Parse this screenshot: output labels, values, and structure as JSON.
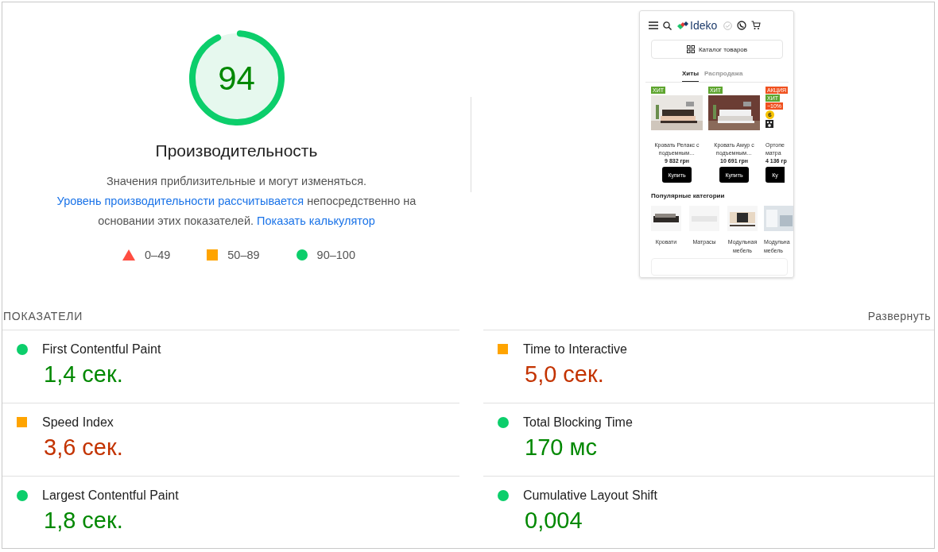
{
  "gauge": {
    "score": "94",
    "level": 0.94,
    "title": "Производительность"
  },
  "description": [
    {
      "kind": "text",
      "text": "Значения приблизительные и могут изменяться. "
    },
    {
      "kind": "link",
      "text": "Уровень"
    },
    {
      "kind": "link",
      "text": "производительности рассчитывается"
    },
    {
      "kind": "text",
      "text": " непосредственно на основании этих показателей. "
    },
    {
      "kind": "link",
      "text": "Показать калькулятор"
    }
  ],
  "legend": [
    {
      "kind": "fail",
      "range": "0–49"
    },
    {
      "kind": "average",
      "range": "50–89"
    },
    {
      "kind": "pass",
      "range": "90–100"
    }
  ],
  "screenshot": {
    "logo": "Ideko",
    "catalog_button": "Каталог товаров",
    "tabs": [
      {
        "label": "Хиты",
        "selected": true
      },
      {
        "label": "Распродажа",
        "selected": false
      }
    ],
    "products": [
      {
        "badges": [
          {
            "text": "ХИТ",
            "color": "#5ea52f"
          }
        ],
        "name_lines": [
          "Кровать Релакс с",
          "подъемным…"
        ],
        "price": "9 832 грн",
        "buy": "Купить"
      },
      {
        "badges": [
          {
            "text": "ХИТ",
            "color": "#5ea52f"
          }
        ],
        "name_lines": [
          "Кровать Амур с",
          "подъемным…"
        ],
        "price": "10 691 грн",
        "buy": "Купить"
      },
      {
        "badges": [
          {
            "text": "АКЦИЯ",
            "color": "#f0511f"
          },
          {
            "text": "ХИТ",
            "color": "#5ea52f"
          },
          {
            "text": "−10%",
            "color": "#f0511f"
          }
        ],
        "bonus": "6",
        "name_lines": [
          "Ортопе",
          "матра"
        ],
        "price": "4 136 гр",
        "buy": "Ку"
      }
    ],
    "categories_title": "Популярные категории",
    "categories": [
      {
        "lines": [
          "Кровати"
        ]
      },
      {
        "lines": [
          "Матрасы"
        ]
      },
      {
        "lines": [
          "Модульная",
          "мебель"
        ]
      },
      {
        "lines": [
          "Модульна",
          "мебель"
        ]
      }
    ]
  },
  "metrics": {
    "title": "ПОКАЗАТЕЛИ",
    "toggle": "Развернуть",
    "items": [
      {
        "name": "First Contentful Paint",
        "value": "1,4 сек.",
        "kind": "pass"
      },
      {
        "name": "Time to Interactive",
        "value": "5,0 сек.",
        "kind": "average"
      },
      {
        "name": "Speed Index",
        "value": "3,6 сек.",
        "kind": "average"
      },
      {
        "name": "Total Blocking Time",
        "value": "170 мс",
        "kind": "pass"
      },
      {
        "name": "Largest Contentful Paint",
        "value": "1,8 сек.",
        "kind": "pass"
      },
      {
        "name": "Cumulative Layout Shift",
        "value": "0,004",
        "kind": "pass"
      }
    ]
  }
}
